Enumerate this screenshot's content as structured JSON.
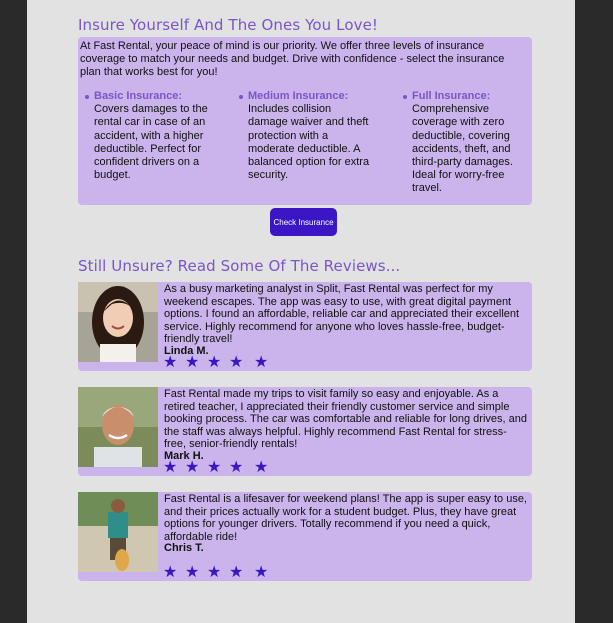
{
  "insurance": {
    "heading": "Insure Yourself And The Ones You Love!",
    "intro": "At Fast Rental, your peace of mind is our priority. We offer three levels of insurance coverage to match your needs and budget. Drive with confidence - select the insurance plan that works best for you!",
    "tiers": [
      {
        "title": "Basic Insurance:",
        "desc": "Covers damages to the rental car in case of an accident, with a higher deductible. Perfect for confident drivers on a budget."
      },
      {
        "title": "Medium Insurance:",
        "desc": "Includes collision damage waiver and theft protection with a moderate deductible. A balanced option for extra security."
      },
      {
        "title": "Full Insurance:",
        "desc": "Comprehensive coverage with zero deductible, covering accidents, theft, and third-party damages. Ideal for worry-free travel."
      }
    ],
    "button_label": "Check Insurance"
  },
  "reviews": {
    "heading": "Still Unsure? Read Some Of The Reviews...",
    "items": [
      {
        "text": "As a busy marketing analyst in Split, Fast Rental was perfect for my weekend escapes. The app was easy to use, with great digital payment options. I found an affordable, reliable car and appreciated their excellent service. Highly recommend for anyone who loves hassle-free, budget-friendly travel!",
        "name": "Linda M.",
        "rating": 5
      },
      {
        "text": "Fast Rental made my trips to visit family so easy and enjoyable. As a retired teacher, I appreciated their friendly customer service and simple booking process. The car was comfortable and reliable for long drives, and the staff was always helpful. Highly recommend Fast Rental for stress-free, senior-friendly rentals!",
        "name": "Mark H.",
        "rating": 5
      },
      {
        "text": "Fast Rental is a lifesaver for weekend plans! The app is super easy to use, and their prices actually work for a student budget. Plus, they have great options for younger drivers. Totally recommend if you need a quick, affordable ride!",
        "name": "Chris T.",
        "rating": 5
      }
    ],
    "star_glyph": "★"
  },
  "colors": {
    "accent": "#7a55c8",
    "card": "#cbb4ec",
    "button": "#3a16c4",
    "page": "#e2e2e2"
  }
}
